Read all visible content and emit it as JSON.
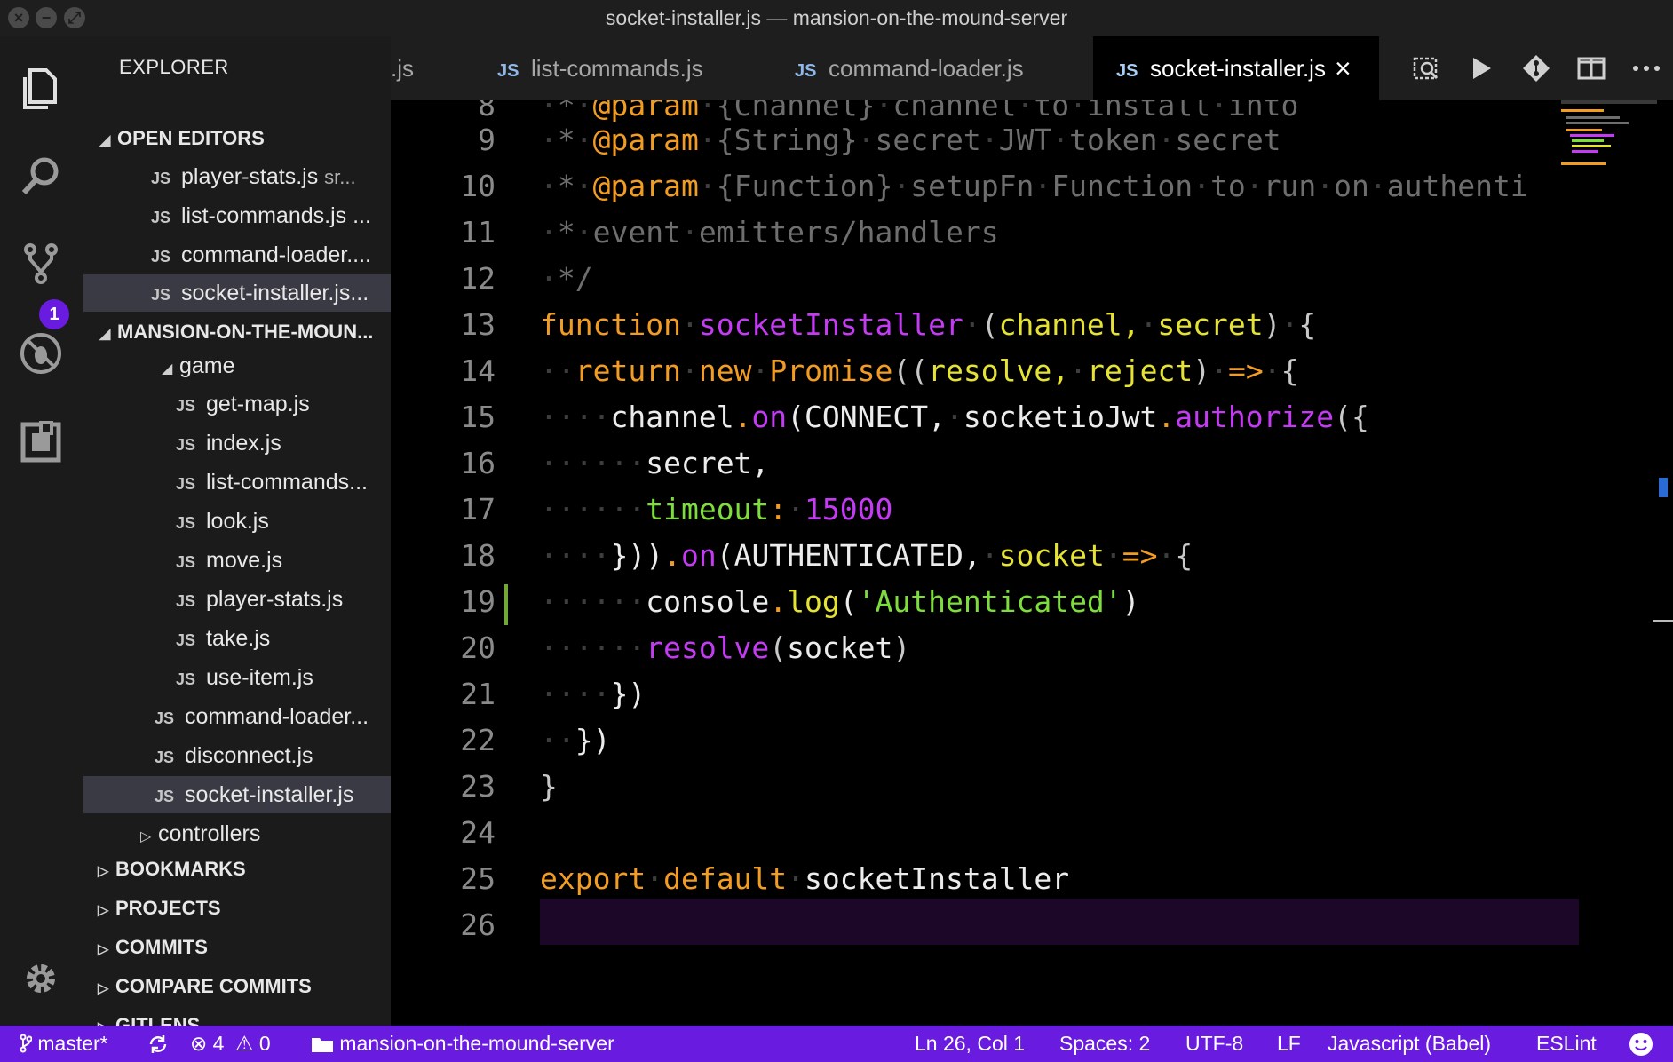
{
  "window": {
    "title": "socket-installer.js — mansion-on-the-mound-server",
    "controls": [
      "close",
      "minimize",
      "maximize"
    ]
  },
  "activity_bar": {
    "items": [
      "files-icon",
      "search-icon",
      "source-control-icon",
      "debug-icon",
      "extensions-icon"
    ],
    "scm_badge": "1",
    "bottom": "gear-icon"
  },
  "sidebar": {
    "title": "EXPLORER",
    "open_editors": {
      "label": "OPEN EDITORS",
      "items": [
        {
          "name": "player-stats.js",
          "hint": "sr..."
        },
        {
          "name": "list-commands.js ...",
          "hint": ""
        },
        {
          "name": "command-loader....",
          "hint": ""
        },
        {
          "name": "socket-installer.js...",
          "hint": ""
        }
      ]
    },
    "project": {
      "label": "MANSION-ON-THE-MOUN...",
      "folder": "game",
      "files": [
        "get-map.js",
        "index.js",
        "list-commands...",
        "look.js",
        "move.js",
        "player-stats.js",
        "take.js",
        "use-item.js"
      ],
      "root_files": [
        "command-loader...",
        "disconnect.js",
        "socket-installer.js"
      ],
      "subfolder": "controllers"
    },
    "sections": [
      "BOOKMARKS",
      "PROJECTS",
      "COMMITS",
      "COMPARE COMMITS",
      "GITLENS"
    ],
    "file_badge": "JS"
  },
  "tabs": {
    "items": [
      {
        "label": ".js",
        "badge": ""
      },
      {
        "label": "list-commands.js",
        "badge": "JS"
      },
      {
        "label": "command-loader.js",
        "badge": "JS"
      },
      {
        "label": "socket-installer.js",
        "badge": "JS"
      }
    ],
    "close": "×",
    "actions": [
      "search-preview-icon",
      "run-icon",
      "git-compare-icon",
      "split-editor-icon",
      "more-icon"
    ]
  },
  "editor": {
    "line_numbers": [
      "8",
      "9",
      "10",
      "11",
      "12",
      "13",
      "14",
      "15",
      "16",
      "17",
      "18",
      "19",
      "20",
      "21",
      "22",
      "23",
      "24",
      "25",
      "26"
    ],
    "cursor_line": "26"
  },
  "statusbar": {
    "branch": "master*",
    "errors": "4",
    "warnings": "0",
    "folder": "mansion-on-the-mound-server",
    "position": "Ln 26, Col 1",
    "spaces": "Spaces: 2",
    "encoding": "UTF-8",
    "eol": "LF",
    "language": "Javascript (Babel)",
    "linter": "ESLint"
  },
  "colors": {
    "accent": "#6a1be0",
    "keyword": "#f29c22",
    "function": "#c43bf3",
    "param": "#e5e234",
    "string": "#7ddd3b",
    "comment": "#6e6e6e"
  }
}
